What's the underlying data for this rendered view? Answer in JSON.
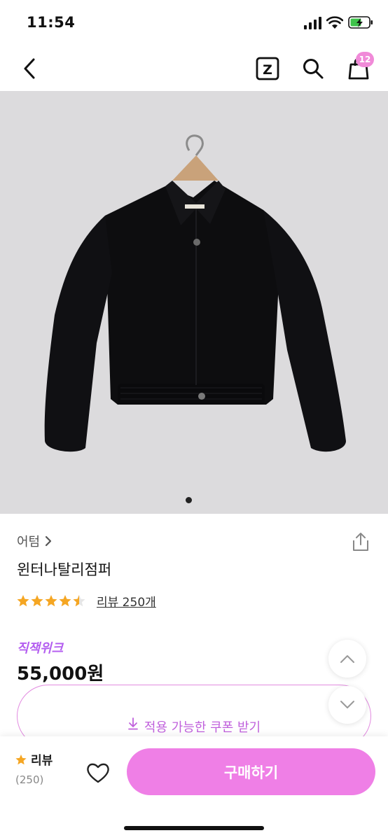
{
  "status_bar": {
    "time": "11:54"
  },
  "nav": {
    "back_icon": "chevron-left-icon",
    "zigzag_icon": "zigzag-logo-icon",
    "zigzag_letter": "Z",
    "search_icon": "search-icon",
    "cart_icon": "shopping-bag-icon",
    "cart_count": "12"
  },
  "product": {
    "image": "black-cropped-jacket-on-hanger",
    "carousel_dots": 1,
    "brand": "어텀",
    "title": "윈터나탈리점퍼",
    "rating": 4.5,
    "review_link": "리뷰 250개",
    "promo_label": "직잭위크",
    "price": "55,000원"
  },
  "coupon": {
    "label": "적용 가능한 쿠폰 받기"
  },
  "bottom_bar": {
    "review_label": "리뷰",
    "review_count": "(250)",
    "buy_label": "구매하기"
  },
  "colors": {
    "accent": "#ef7fe6",
    "promo": "#b45ff0",
    "star": "#f5a623",
    "image_bg": "#dcdbdd"
  }
}
